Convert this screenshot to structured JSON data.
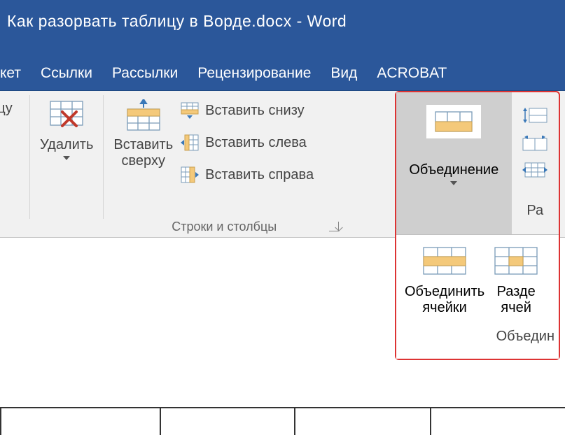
{
  "colors": {
    "brand": "#2b579a",
    "highlight_border": "#d33",
    "ribbon_bg": "#f1f1f1",
    "selected_bg": "#cfcfcf"
  },
  "titlebar": {
    "document_title": "Как разорвать таблицу в Ворде.docx - Word"
  },
  "tabs": {
    "partial_first": "кет",
    "links": "Ссылки",
    "mailings": "Рассылки",
    "review": "Рецензирование",
    "view": "Вид",
    "acrobat": "ACROBAT"
  },
  "ribbon": {
    "group0_label_fragment": "цу",
    "delete_label": "Удалить",
    "insert_above_label": "Вставить\nсверху",
    "insert_below_label": "Вставить снизу",
    "insert_left_label": "Вставить слева",
    "insert_right_label": "Вставить справа",
    "rows_cols_group_label": "Строки и столбцы"
  },
  "merge": {
    "big_button_label": "Объединение",
    "right_text_fragment": "Ра",
    "dropdown": {
      "merge_cells": "Объединить\nячейки",
      "split_cells_fragment": "Разде\nячей",
      "group_label_fragment": "Объедин"
    }
  }
}
